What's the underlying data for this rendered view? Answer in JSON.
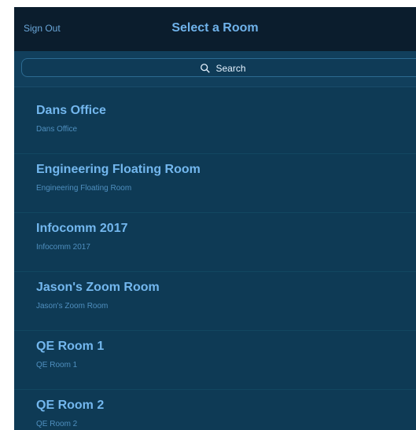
{
  "header": {
    "sign_out_label": "Sign Out",
    "title": "Select a Room"
  },
  "search": {
    "placeholder": "Search"
  },
  "rooms": [
    {
      "name": "Dans Office",
      "subtitle": "Dans Office"
    },
    {
      "name": "Engineering Floating Room",
      "subtitle": "Engineering Floating Room"
    },
    {
      "name": "Infocomm 2017",
      "subtitle": "Infocomm 2017"
    },
    {
      "name": "Jason's Zoom Room",
      "subtitle": "Jason's Zoom Room"
    },
    {
      "name": "QE Room 1",
      "subtitle": "QE Room 1"
    },
    {
      "name": "QE Room 2",
      "subtitle": "QE Room 2"
    }
  ],
  "colors": {
    "topbar_bg": "#0b1d2d",
    "content_bg": "#0e3a55",
    "accent": "#73b7ee"
  },
  "icons": {
    "search": "search-icon"
  }
}
